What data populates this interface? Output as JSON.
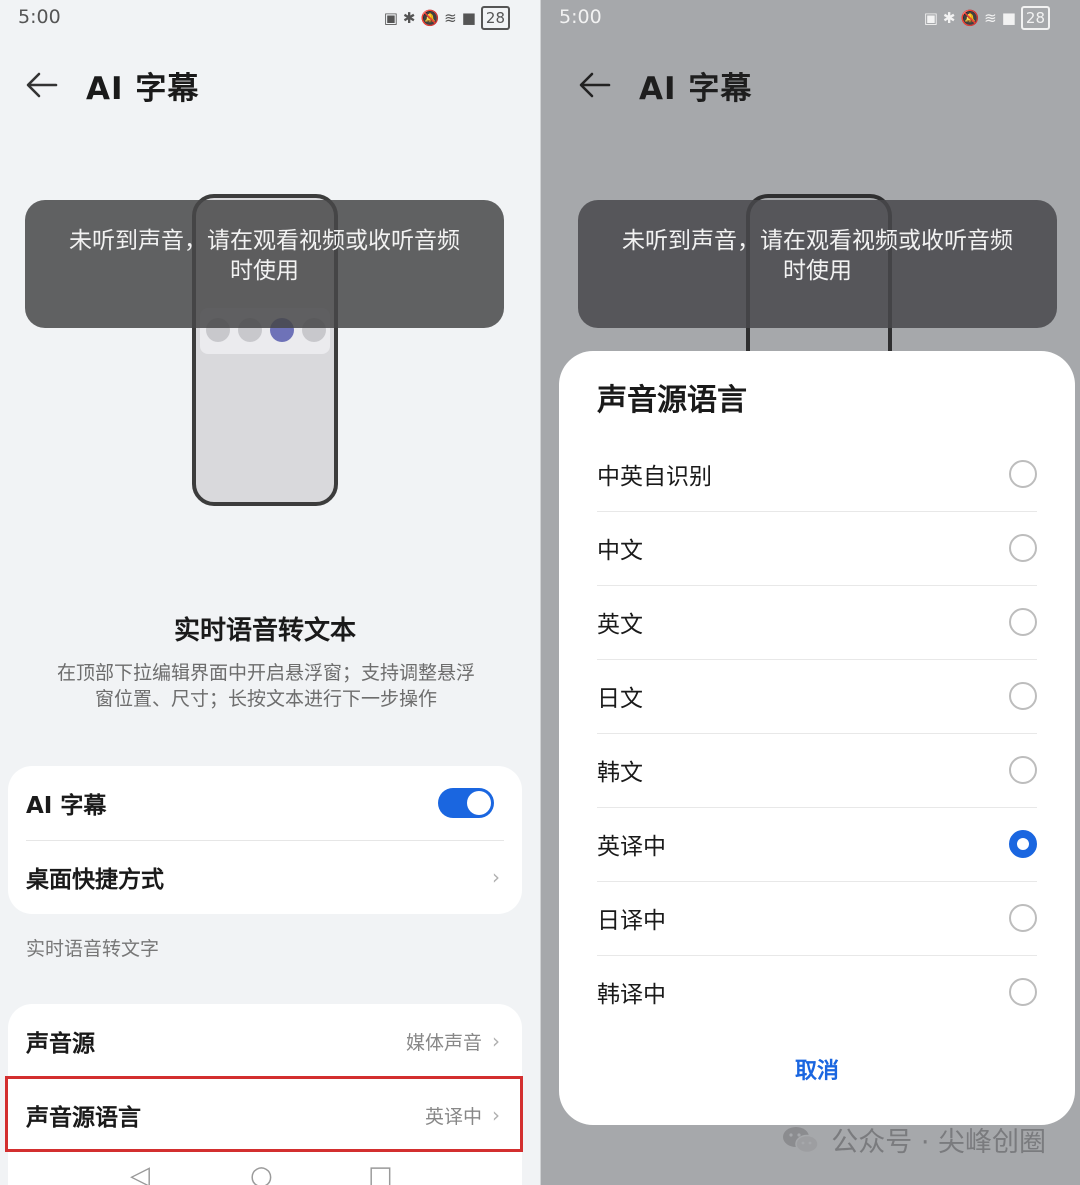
{
  "left": {
    "status": {
      "time": "5:00",
      "battery": "28"
    },
    "title": "AI 字幕",
    "toast": [
      "未听到声音，请在观看视频或收听音频",
      "时使用"
    ],
    "section_title": "实时语音转文本",
    "section_desc": [
      "在顶部下拉编辑界面中开启悬浮窗；支持调整悬浮",
      "窗位置、尺寸；长按文本进行下一步操作"
    ],
    "card1": {
      "ai_caption_label": "AI 字幕",
      "ai_caption_enabled": true,
      "shortcut_label": "桌面快捷方式"
    },
    "group_label": "实时语音转文字",
    "card2": {
      "source_label": "声音源",
      "source_value": "媒体声音",
      "language_label": "声音源语言",
      "language_value": "英译中"
    }
  },
  "right": {
    "status": {
      "time": "5:00",
      "battery": "28"
    },
    "title": "AI 字幕",
    "toast": [
      "未听到声音，请在观看视频或收听音频",
      "时使用"
    ],
    "sheet": {
      "title": "声音源语言",
      "options": [
        {
          "label": "中英自识别",
          "selected": false
        },
        {
          "label": "中文",
          "selected": false
        },
        {
          "label": "英文",
          "selected": false
        },
        {
          "label": "日文",
          "selected": false
        },
        {
          "label": "韩文",
          "selected": false
        },
        {
          "label": "英译中",
          "selected": true
        },
        {
          "label": "日译中",
          "selected": false
        },
        {
          "label": "韩译中",
          "selected": false
        }
      ],
      "cancel_label": "取消"
    },
    "watermark": "公众号 · 尖峰创圈"
  },
  "colors": {
    "accent": "#1a66e0",
    "highlight": "#d32f2f"
  }
}
